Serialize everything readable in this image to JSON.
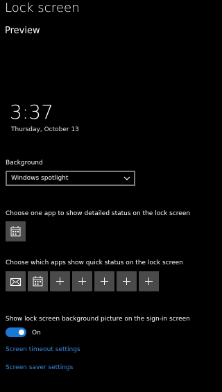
{
  "header": {
    "title": "Lock screen"
  },
  "preview": {
    "heading": "Preview",
    "time": "3:37",
    "date": "Thursday, October 13"
  },
  "background": {
    "label": "Background",
    "selected": "Windows spotlight"
  },
  "detailed_status": {
    "label": "Choose one app to show detailed status on the lock screen",
    "apps": [
      {
        "icon": "calendar-icon"
      }
    ]
  },
  "quick_status": {
    "label": "Choose which apps show quick status on the lock screen",
    "apps": [
      {
        "icon": "mail-icon"
      },
      {
        "icon": "calendar-icon"
      },
      {
        "icon": "plus-icon"
      },
      {
        "icon": "plus-icon"
      },
      {
        "icon": "plus-icon"
      },
      {
        "icon": "plus-icon"
      },
      {
        "icon": "plus-icon"
      }
    ]
  },
  "signin_background": {
    "label": "Show lock screen background picture on the sign-in screen",
    "state": "On",
    "enabled": true
  },
  "links": {
    "screen_timeout": "Screen timeout settings",
    "screen_saver": "Screen saver settings"
  },
  "colors": {
    "background": "#000000",
    "accent": "#1a78d4",
    "link": "#3a8ee6",
    "tile": "#4a4a4a"
  }
}
